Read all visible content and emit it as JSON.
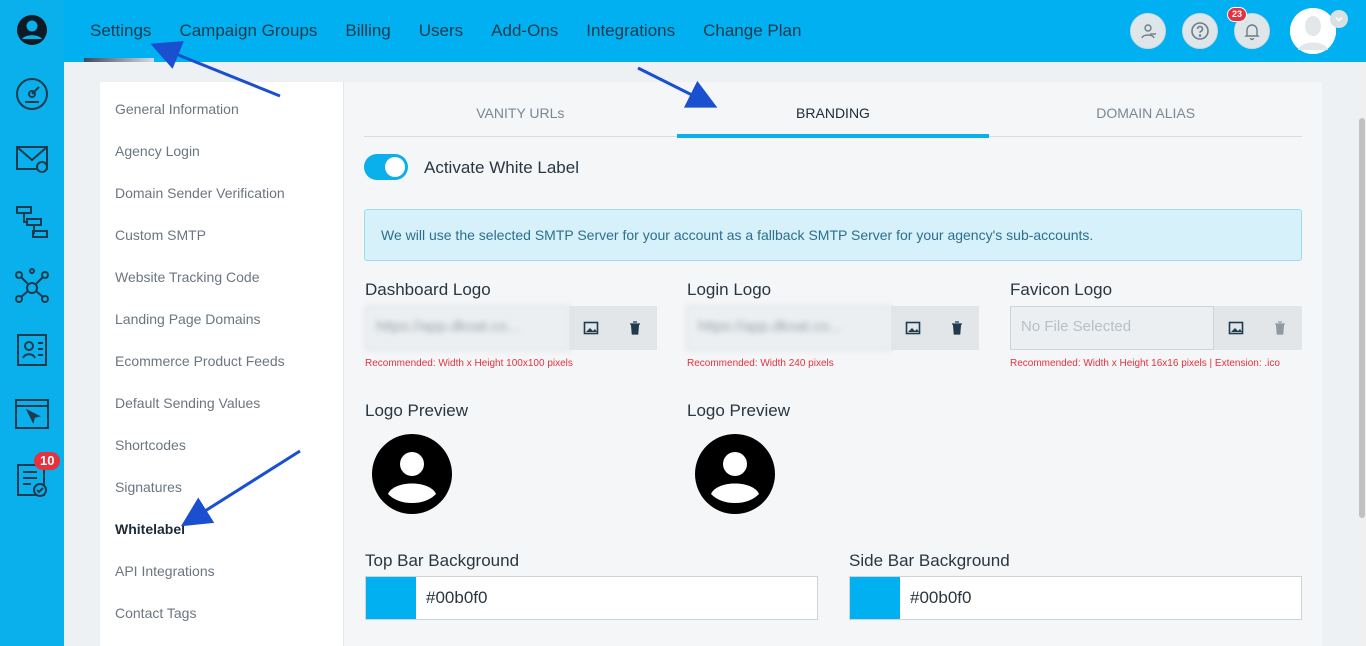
{
  "rail": {
    "icons": [
      "user-circle-icon",
      "dashboard-gauge-icon",
      "email-campaign-icon",
      "automation-flow-icon",
      "network-hub-icon",
      "contacts-list-icon",
      "browser-pointer-icon",
      "tasks-clipboard-icon"
    ],
    "tasks_badge": "10",
    "color": "#0ab0ec"
  },
  "topbar": {
    "nav": [
      "Settings",
      "Campaign Groups",
      "Billing",
      "Users",
      "Add-Ons",
      "Integrations",
      "Change Plan"
    ],
    "notification_count": "23",
    "color": "#00b0f0"
  },
  "side_menu": {
    "items": [
      "General Information",
      "Agency Login",
      "Domain Sender Verification",
      "Custom SMTP",
      "Website Tracking Code",
      "Landing Page Domains",
      "Ecommerce Product Feeds",
      "Default Sending Values",
      "Shortcodes",
      "Signatures",
      "Whitelabel",
      "API Integrations",
      "Contact Tags"
    ],
    "active": "Whitelabel"
  },
  "tabs": {
    "items": [
      "VANITY URLs",
      "BRANDING",
      "DOMAIN ALIAS"
    ],
    "active": "BRANDING"
  },
  "branding": {
    "toggle_label": "Activate White Label",
    "toggle_on": true,
    "info": "We will use the selected SMTP Server for your account as a fallback SMTP Server for your agency's sub-accounts.",
    "logos": [
      {
        "title": "Dashboard Logo",
        "value": "https://app.dkoat.co...",
        "hint": "Recommended: Width x Height 100x100 pixels"
      },
      {
        "title": "Login Logo",
        "value": "https://app.dkoat.co...",
        "hint": "Recommended: Width 240 pixels"
      },
      {
        "title": "Favicon Logo",
        "placeholder": "No File Selected",
        "hint": "Recommended: Width x Height 16x16 pixels | Extension: .ico"
      }
    ],
    "preview_label": "Logo Preview",
    "colors": [
      {
        "title": "Top Bar Background",
        "value": "#00b0f0"
      },
      {
        "title": "Side Bar Background",
        "value": "#00b0f0"
      }
    ]
  },
  "annotation_color": "#1a4fd0"
}
